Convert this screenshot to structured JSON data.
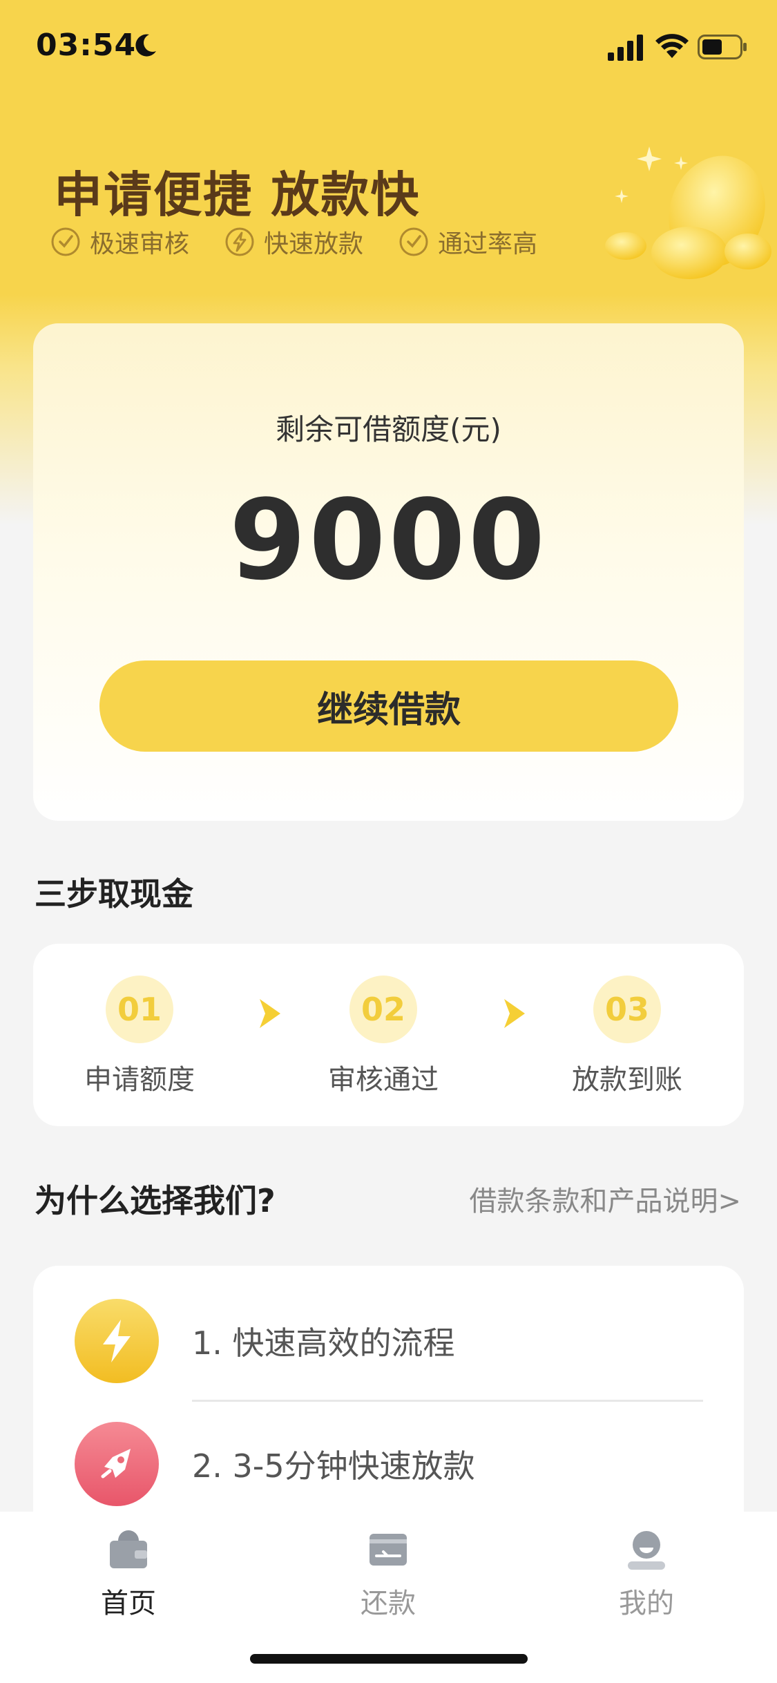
{
  "status_bar": {
    "time": "03:54"
  },
  "header": {
    "title": "申请便捷 放款快",
    "features": [
      {
        "icon": "check-circle-icon",
        "label": "极速审核"
      },
      {
        "icon": "lightning-circle-icon",
        "label": "快速放款"
      },
      {
        "icon": "check-circle-icon",
        "label": "通过率高"
      }
    ]
  },
  "quota_card": {
    "label": "剩余可借额度(元)",
    "amount": "9000",
    "button_label": "继续借款"
  },
  "steps_section": {
    "title": "三步取现金",
    "steps": [
      {
        "number": "01",
        "label": "申请额度"
      },
      {
        "number": "02",
        "label": "审核通过"
      },
      {
        "number": "03",
        "label": "放款到账"
      }
    ]
  },
  "why_section": {
    "title": "为什么选择我们?",
    "link": "借款条款和产品说明>",
    "items": [
      {
        "icon": "lightning-icon",
        "text": "1. 快速高效的流程"
      },
      {
        "icon": "rocket-icon",
        "text": "2. 3-5分钟快速放款"
      }
    ]
  },
  "tabbar": {
    "tabs": [
      {
        "icon": "wallet-icon",
        "label": "首页",
        "active": true
      },
      {
        "icon": "repay-card-icon",
        "label": "还款",
        "active": false
      },
      {
        "icon": "user-icon",
        "label": "我的",
        "active": false
      }
    ]
  },
  "colors": {
    "brand_yellow": "#f7d44c",
    "title_brown": "#5a3a1a",
    "rocket_red": "#ec6a78"
  }
}
